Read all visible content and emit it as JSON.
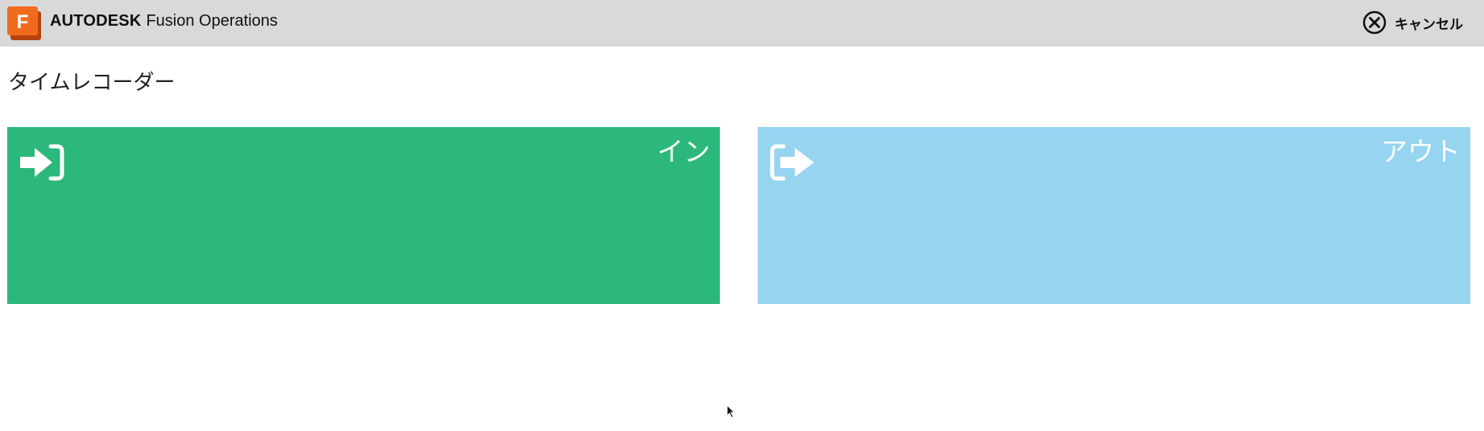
{
  "header": {
    "brand_strong": "AUTODESK",
    "brand_product": "Fusion Operations",
    "logo_letter": "F",
    "cancel_label": "キャンセル"
  },
  "page": {
    "title": "タイムレコーダー"
  },
  "tiles": [
    {
      "label": "イン",
      "color": "#2bb87a",
      "icon": "sign-in-icon"
    },
    {
      "label": "アウト",
      "color": "#96d4f0",
      "icon": "sign-out-icon"
    }
  ],
  "colors": {
    "header_bg": "#d9d9d9",
    "logo_orange": "#f26b1d"
  }
}
